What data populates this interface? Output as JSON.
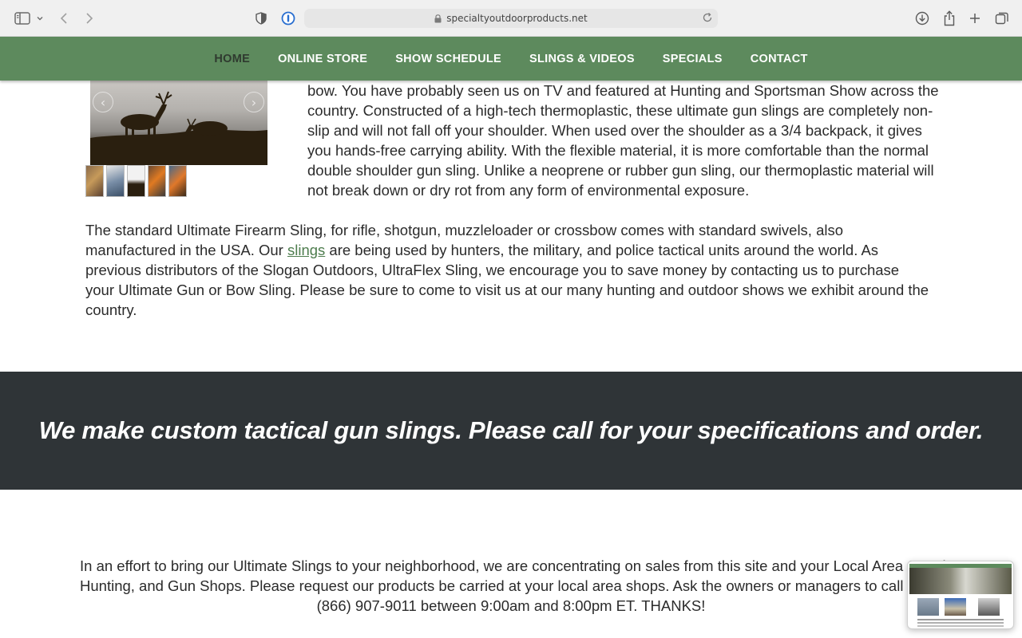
{
  "browser": {
    "url": "specialtyoutdoorproducts.net",
    "icons": {
      "sidebar": "sidebar-icon",
      "back": "back-arrow-icon",
      "forward": "forward-arrow-icon",
      "privacy": "shield-icon",
      "password": "password-manager-icon",
      "lock": "lock-icon",
      "reload": "reload-icon",
      "download": "download-icon",
      "share": "share-icon",
      "new_tab": "plus-icon",
      "tabs": "tab-overview-icon"
    }
  },
  "nav": {
    "items": [
      {
        "label": "HOME",
        "active": true
      },
      {
        "label": "ONLINE STORE"
      },
      {
        "label": "SHOW SCHEDULE"
      },
      {
        "label": "SLINGS & VIDEOS"
      },
      {
        "label": "SPECIALS"
      },
      {
        "label": "CONTACT"
      }
    ],
    "color": "#5d8a5d"
  },
  "slider": {
    "prev_glyph": "‹",
    "next_glyph": "›"
  },
  "content": {
    "para1": "bow. You have probably seen us on TV and featured at Hunting and Sportsman Show across the country. Constructed of a high-tech thermoplastic, these ultimate gun slings are completely non-slip and will not fall off your shoulder. When used over the shoulder as a 3/4 backpack, it gives you hands-free carrying ability. With the flexible material, it is more comfortable than the normal double shoulder gun sling. Unlike a neoprene or rubber gun sling, our thermoplastic material will not break down or dry rot from any form of environmental exposure.",
    "para2_before": "The standard Ultimate Firearm Sling, for rifle, shotgun, muzzleloader or crossbow comes with standard swivels, also manufactured in the USA. Our ",
    "para2_link": "slings",
    "para2_after": " are being used by hunters, the military, and police tactical units around the world. As previous distributors of the Slogan Outdoors, UltraFlex Sling, we encourage you to save money by contacting us to purchase your Ultimate Gun or Bow Sling. Please be sure to come to visit us at our many hunting and outdoor shows we exhibit around the country.",
    "banner": "We make custom tactical gun slings. Please call for your specifications and order.",
    "para3_line1": "In an effort to bring our Ultimate Slings to your neighborhood, we are concentrating on sales from this site and your Local Area Sporting,",
    "para3_line2": "Hunting, and Gun Shops. Please request our products be carried at your local area shops. Ask the owners or managers to call us TODAY at",
    "para3_line3": "(866) 907-9011 between 9:00am and 8:00pm ET. THANKS!"
  },
  "colors": {
    "banner_bg": "#2f3437",
    "link": "#4e7d4e"
  }
}
